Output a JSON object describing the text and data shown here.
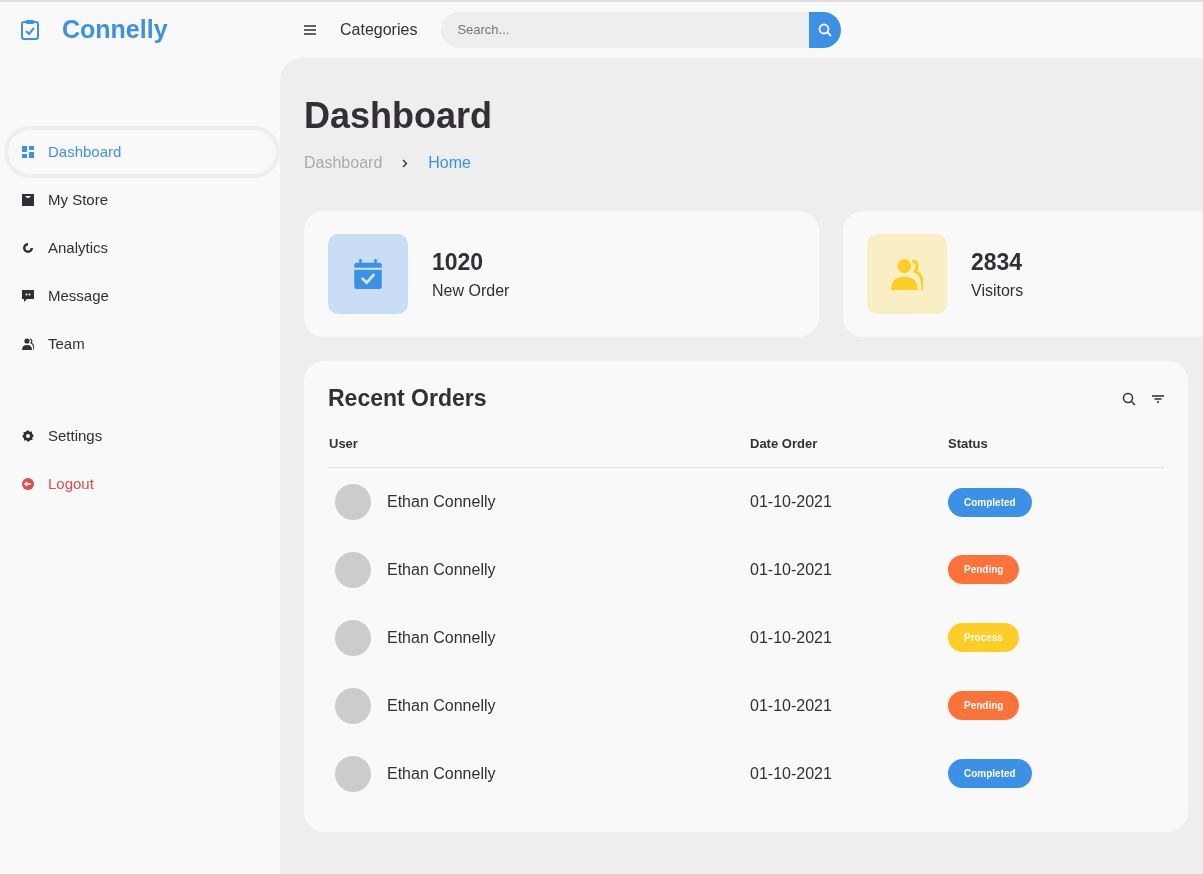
{
  "brand": {
    "name": "Connelly"
  },
  "topbar": {
    "menu_label": "Categories",
    "search": {
      "placeholder": "Search..."
    }
  },
  "sidebar": {
    "items": [
      {
        "label": "Dashboard",
        "selected": true
      },
      {
        "label": "My Store",
        "selected": false
      },
      {
        "label": "Analytics",
        "selected": false
      },
      {
        "label": "Message",
        "selected": false
      },
      {
        "label": "Team",
        "selected": false
      }
    ],
    "bottom_items": [
      {
        "label": "Settings",
        "kind": "settings"
      },
      {
        "label": "Logout",
        "kind": "logout"
      }
    ]
  },
  "page": {
    "title": "Dashboard",
    "breadcrumb": [
      {
        "label": "Dashboard",
        "selected": false
      },
      {
        "label": "Home",
        "selected": true
      }
    ]
  },
  "stats": [
    {
      "value": "1020",
      "label": "New Order",
      "color": "#3c91e6"
    },
    {
      "value": "2834",
      "label": "Visitors",
      "color": "#ffce26"
    }
  ],
  "orders": {
    "title": "Recent Orders",
    "columns": [
      "User",
      "Date Order",
      "Status"
    ],
    "rows": [
      {
        "user": "Ethan Connelly",
        "date": "01-10-2021",
        "status": "Completed",
        "color": "#3c91e6"
      },
      {
        "user": "Ethan Connelly",
        "date": "01-10-2021",
        "status": "Pending",
        "color": "#fd7238"
      },
      {
        "user": "Ethan Connelly",
        "date": "01-10-2021",
        "status": "Process",
        "color": "#ffce26"
      },
      {
        "user": "Ethan Connelly",
        "date": "01-10-2021",
        "status": "Pending",
        "color": "#fd7238"
      },
      {
        "user": "Ethan Connelly",
        "date": "01-10-2021",
        "status": "Completed",
        "color": "#3c91e6"
      }
    ]
  }
}
